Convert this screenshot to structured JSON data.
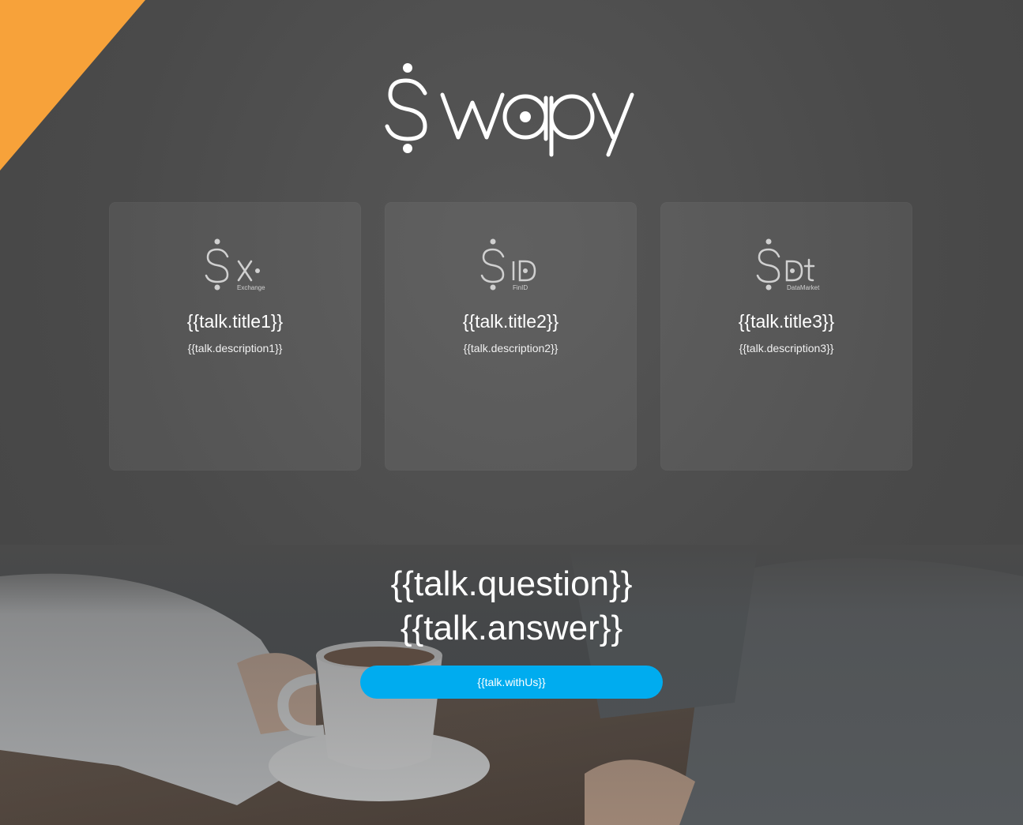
{
  "brand": {
    "name": "Swapy",
    "accent_color": "#f7a23a",
    "button_color": "#00acef"
  },
  "cards": [
    {
      "logo_letters": "x",
      "logo_caption": "Exchange",
      "title": "{{talk.title1}}",
      "description": "{{talk.description1}}"
    },
    {
      "logo_letters": "ID",
      "logo_caption": "FinID",
      "title": "{{talk.title2}}",
      "description": "{{talk.description2}}"
    },
    {
      "logo_letters": "Dt",
      "logo_caption": "DataMarket",
      "title": "{{talk.title3}}",
      "description": "{{talk.description3}}"
    }
  ],
  "cta": {
    "question": "{{talk.question}}",
    "answer": "{{talk.answer}}",
    "button_label": "{{talk.withUs}}"
  },
  "background": {
    "image_icon": "coffee-meeting-photo"
  }
}
